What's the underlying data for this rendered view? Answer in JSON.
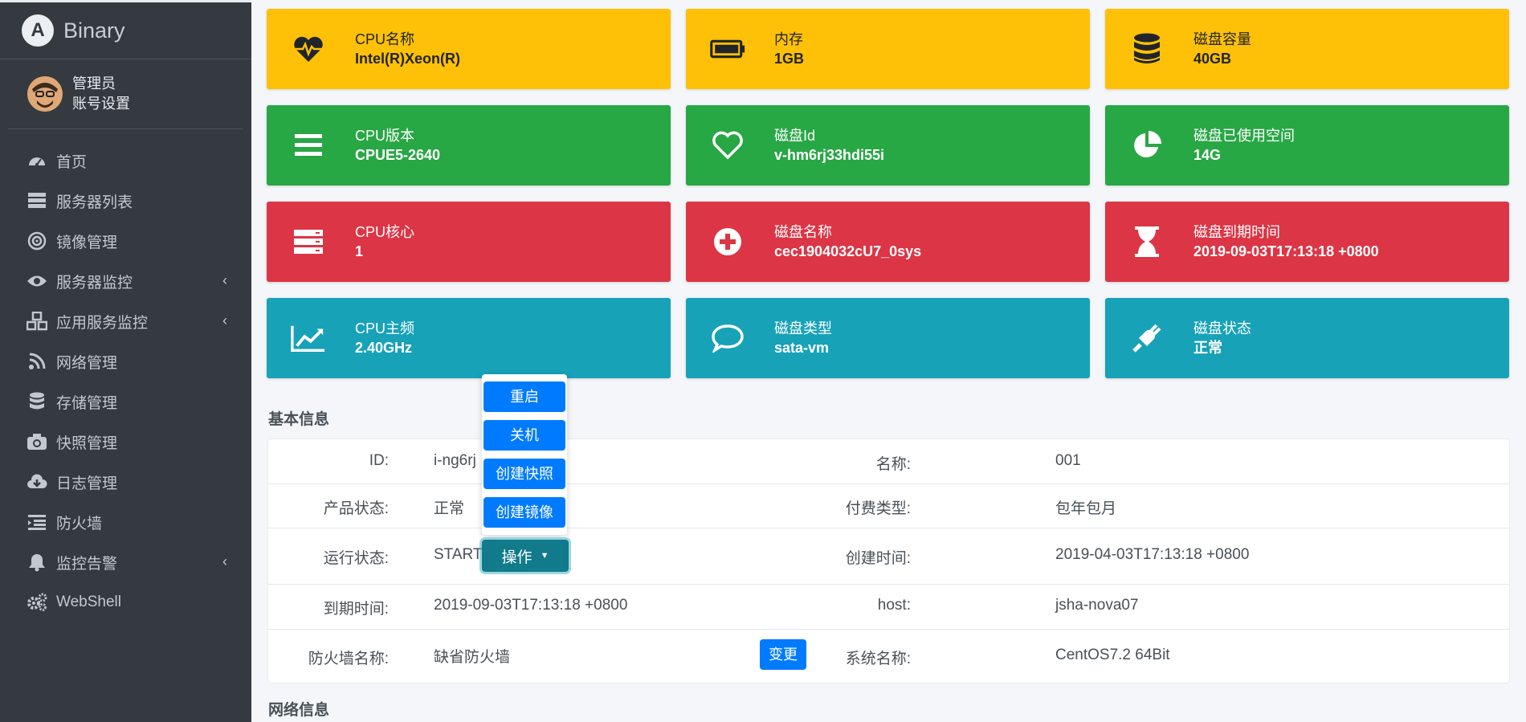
{
  "brand": {
    "logo_letter": "A",
    "name": "Binary"
  },
  "user": {
    "name": "管理员",
    "settings": "账号设置"
  },
  "nav": [
    {
      "label": "首页",
      "icon": "dashboard-icon",
      "arrow": false
    },
    {
      "label": "服务器列表",
      "icon": "server-icon",
      "arrow": false
    },
    {
      "label": "镜像管理",
      "icon": "target-icon",
      "arrow": false
    },
    {
      "label": "服务器监控",
      "icon": "eye-icon",
      "arrow": true
    },
    {
      "label": "应用服务监控",
      "icon": "cubes-icon",
      "arrow": true
    },
    {
      "label": "网络管理",
      "icon": "rss-icon",
      "arrow": false
    },
    {
      "label": "存储管理",
      "icon": "database-icon",
      "arrow": false
    },
    {
      "label": "快照管理",
      "icon": "camera-icon",
      "arrow": false
    },
    {
      "label": "日志管理",
      "icon": "cloud-download-icon",
      "arrow": false
    },
    {
      "label": "防火墙",
      "icon": "firewall-icon",
      "arrow": false
    },
    {
      "label": "监控告警",
      "icon": "bell-icon",
      "arrow": true
    },
    {
      "label": "WebShell",
      "icon": "cogs-icon",
      "arrow": false
    }
  ],
  "info_boxes": [
    {
      "label": "CPU名称",
      "value": "Intel(R)Xeon(R)",
      "color": "#ffc107",
      "icon": "heartbeat-icon"
    },
    {
      "label": "内存",
      "value": "1GB",
      "color": "#ffc107",
      "icon": "battery-icon"
    },
    {
      "label": "磁盘容量",
      "value": "40GB",
      "color": "#ffc107",
      "icon": "database-icon"
    },
    {
      "label": "CPU版本",
      "value": "CPUE5-2640",
      "color": "#28a745",
      "icon": "bars-icon"
    },
    {
      "label": "磁盘Id",
      "value": "v-hm6rj33hdi55i",
      "color": "#28a745",
      "icon": "heart-icon"
    },
    {
      "label": "磁盘已使用空间",
      "value": "14G",
      "color": "#28a745",
      "icon": "pie-chart-icon"
    },
    {
      "label": "CPU核心",
      "value": "1",
      "color": "#dc3545",
      "icon": "server-icon"
    },
    {
      "label": "磁盘名称",
      "value": "cec1904032cU7_0sys",
      "color": "#dc3545",
      "icon": "plus-circle-icon"
    },
    {
      "label": "磁盘到期时间",
      "value": "2019-09-03T17:13:18 +0800",
      "color": "#dc3545",
      "icon": "hourglass-icon"
    },
    {
      "label": "CPU主频",
      "value": "2.40GHz",
      "color": "#17a2b8",
      "icon": "line-chart-icon"
    },
    {
      "label": "磁盘类型",
      "value": "sata-vm",
      "color": "#17a2b8",
      "icon": "comment-icon"
    },
    {
      "label": "磁盘状态",
      "value": "正常",
      "color": "#17a2b8",
      "icon": "plug-icon"
    }
  ],
  "basic": {
    "title": "基本信息",
    "id_label": "ID:",
    "id_value": "i-ng6rj",
    "name_label": "名称:",
    "name_value": "001",
    "prod_status_label": "产品状态:",
    "prod_status_value": "正常",
    "pay_type_label": "付费类型:",
    "pay_type_value": "包年包月",
    "run_status_label": "运行状态:",
    "run_status_value": "START",
    "created_label": "创建时间:",
    "created_value": "2019-04-03T17:13:18 +0800",
    "expire_label": "到期时间:",
    "expire_value": "2019-09-03T17:13:18 +0800",
    "host_label": "host:",
    "host_value": "jsha-nova07",
    "fw_label": "防火墙名称:",
    "fw_value": "缺省防火墙",
    "fw_change": "变更",
    "os_label": "系统名称:",
    "os_value": "CentOS7.2 64Bit"
  },
  "actions": {
    "button": "操作",
    "menu": [
      "重启",
      "关机",
      "创建快照",
      "创建镜像"
    ]
  },
  "network": {
    "title": "网络信息"
  }
}
